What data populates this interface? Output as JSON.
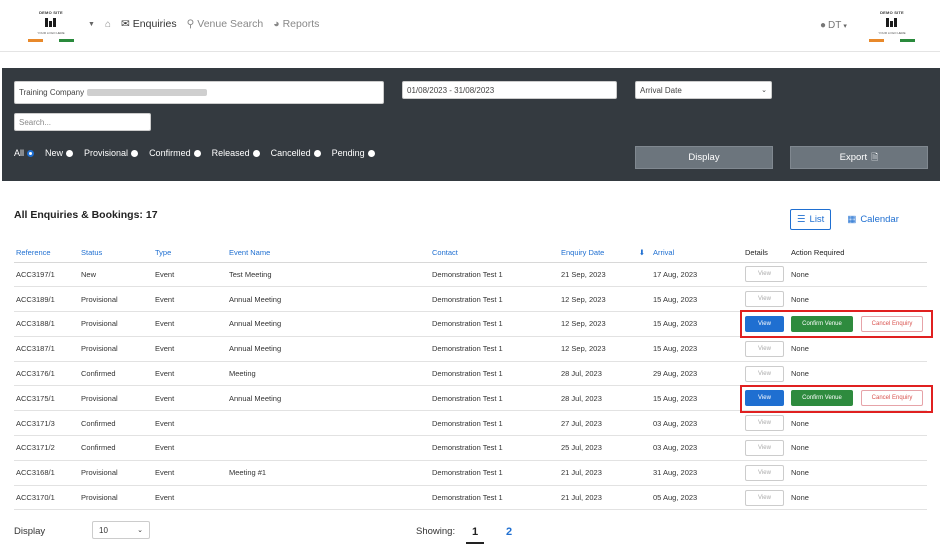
{
  "logo": {
    "title": "DEMO SITE",
    "tagline": "YOUR LOGO HERE"
  },
  "nav": {
    "enquiries": "Enquiries",
    "venue_search": "Venue Search",
    "reports": "Reports",
    "user": "DT"
  },
  "filters": {
    "company": "Training Company",
    "date_range": "01/08/2023 - 31/08/2023",
    "date_type": "Arrival Date",
    "search_placeholder": "Search...",
    "statuses": [
      "All",
      "New",
      "Provisional",
      "Confirmed",
      "Released",
      "Cancelled",
      "Pending"
    ],
    "selected_status": "All",
    "display_label": "Display",
    "export_label": "Export"
  },
  "section": {
    "title": "All Enquiries & Bookings:",
    "count": "17"
  },
  "view": {
    "list": "List",
    "calendar": "Calendar"
  },
  "table": {
    "headers": [
      "Reference",
      "Status",
      "Type",
      "Event Name",
      "Contact",
      "Enquiry Date",
      "Arrival",
      "Details",
      "Action Required"
    ],
    "rows": [
      {
        "ref": "ACC3197/1",
        "status": "New",
        "type": "Event",
        "event": "Test Meeting",
        "contact": "Demonstration Test 1",
        "enq": "21 Sep, 2023",
        "arrival": "17 Aug, 2023",
        "action": "None"
      },
      {
        "ref": "ACC3189/1",
        "status": "Provisional",
        "type": "Event",
        "event": "Annual Meeting",
        "contact": "Demonstration Test 1",
        "enq": "12 Sep, 2023",
        "arrival": "15 Aug, 2023",
        "action": "None"
      },
      {
        "ref": "ACC3188/1",
        "status": "Provisional",
        "type": "Event",
        "event": "Annual Meeting",
        "contact": "Demonstration Test 1",
        "enq": "12 Sep, 2023",
        "arrival": "15 Aug, 2023",
        "action": "buttons"
      },
      {
        "ref": "ACC3187/1",
        "status": "Provisional",
        "type": "Event",
        "event": "Annual Meeting",
        "contact": "Demonstration Test 1",
        "enq": "12 Sep, 2023",
        "arrival": "15 Aug, 2023",
        "action": "None"
      },
      {
        "ref": "ACC3176/1",
        "status": "Confirmed",
        "type": "Event",
        "event": "Meeting",
        "contact": "Demonstration Test 1",
        "enq": "28 Jul, 2023",
        "arrival": "29 Aug, 2023",
        "action": "None"
      },
      {
        "ref": "ACC3175/1",
        "status": "Provisional",
        "type": "Event",
        "event": "Annual Meeting",
        "contact": "Demonstration Test 1",
        "enq": "28 Jul, 2023",
        "arrival": "15 Aug, 2023",
        "action": "buttons"
      },
      {
        "ref": "ACC3171/3",
        "status": "Confirmed",
        "type": "Event",
        "event": "",
        "contact": "Demonstration Test 1",
        "enq": "27 Jul, 2023",
        "arrival": "03 Aug, 2023",
        "action": "None"
      },
      {
        "ref": "ACC3171/2",
        "status": "Confirmed",
        "type": "Event",
        "event": "",
        "contact": "Demonstration Test 1",
        "enq": "25 Jul, 2023",
        "arrival": "03 Aug, 2023",
        "action": "None"
      },
      {
        "ref": "ACC3168/1",
        "status": "Provisional",
        "type": "Event",
        "event": "Meeting #1",
        "contact": "Demonstration Test 1",
        "enq": "21 Jul, 2023",
        "arrival": "31 Aug, 2023",
        "action": "None"
      },
      {
        "ref": "ACC3170/1",
        "status": "Provisional",
        "type": "Event",
        "event": "",
        "contact": "Demonstration Test 1",
        "enq": "21 Jul, 2023",
        "arrival": "05 Aug, 2023",
        "action": "None"
      }
    ],
    "view_label": "View",
    "confirm_label": "Confirm Venue",
    "cancel_label": "Cancel Enquiry"
  },
  "footer": {
    "display_label": "Display",
    "page_size": "10",
    "showing_label": "Showing:",
    "pages": [
      "1",
      "2"
    ]
  },
  "colors": {
    "accent": "#1f6fd1",
    "panel": "#343a40",
    "confirm": "#2e8b3e",
    "cancel": "#d9534f",
    "highlight": "#e02020"
  }
}
